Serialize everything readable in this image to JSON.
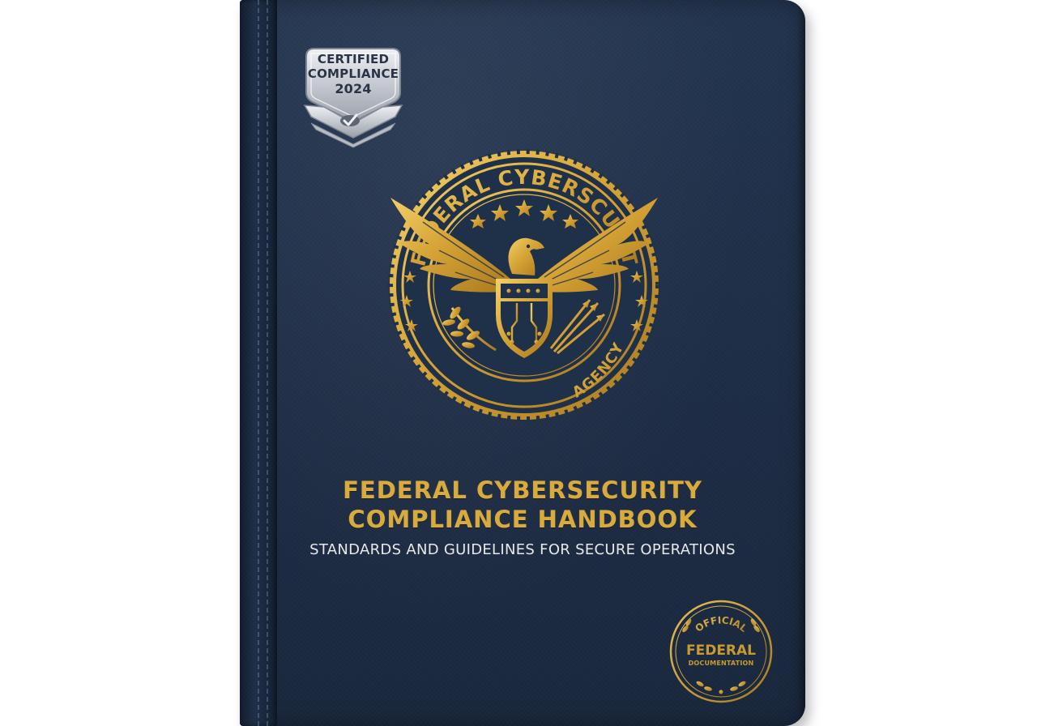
{
  "badge": {
    "line1": "CERTIFIED",
    "line2": "COMPLIANCE",
    "year": "2024"
  },
  "seal": {
    "top_arc": "FEDERAL CYBERSCURIT",
    "bottom_arc": "AGENCY"
  },
  "cover": {
    "title_line1": "FEDERAL CYBERSECURITY",
    "title_line2": "COMPLIANCE HANDBOOK",
    "subtitle": "STANDARDS AND GUIDELINES FOR SECURE OPERATIONS"
  },
  "stamp": {
    "top": "OFFICIAL",
    "main": "FEDERAL",
    "sub": "DOCUMENTATION"
  },
  "colors": {
    "cover": "#1f3049",
    "gold": "#d8ab3c",
    "silver": "#c9ccd2"
  }
}
